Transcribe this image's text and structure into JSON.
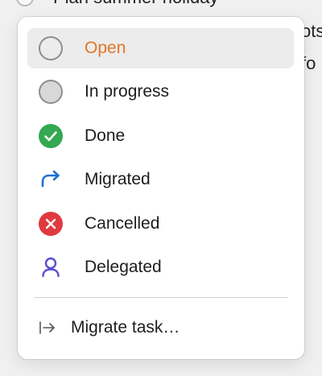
{
  "background": {
    "task_title": "Plan summer holiday",
    "fragment_1": "ots",
    "fragment_2": "fo"
  },
  "menu": {
    "items": [
      {
        "label": "Open",
        "icon": "empty-circle-icon",
        "selected": true
      },
      {
        "label": "In progress",
        "icon": "gray-filled-circle-icon"
      },
      {
        "label": "Done",
        "icon": "green-check-circle-icon"
      },
      {
        "label": "Migrated",
        "icon": "curved-arrow-icon"
      },
      {
        "label": "Cancelled",
        "icon": "red-x-circle-icon"
      },
      {
        "label": "Delegated",
        "icon": "person-icon"
      }
    ],
    "action": {
      "label": "Migrate task…",
      "icon": "arrow-to-bar-icon"
    }
  },
  "colors": {
    "accent_selected_text": "#e27624",
    "done_green": "#34a853",
    "cancel_red": "#e0393f",
    "migrate_blue": "#1f6fd6",
    "delegate_purple": "#5a4fcf"
  }
}
